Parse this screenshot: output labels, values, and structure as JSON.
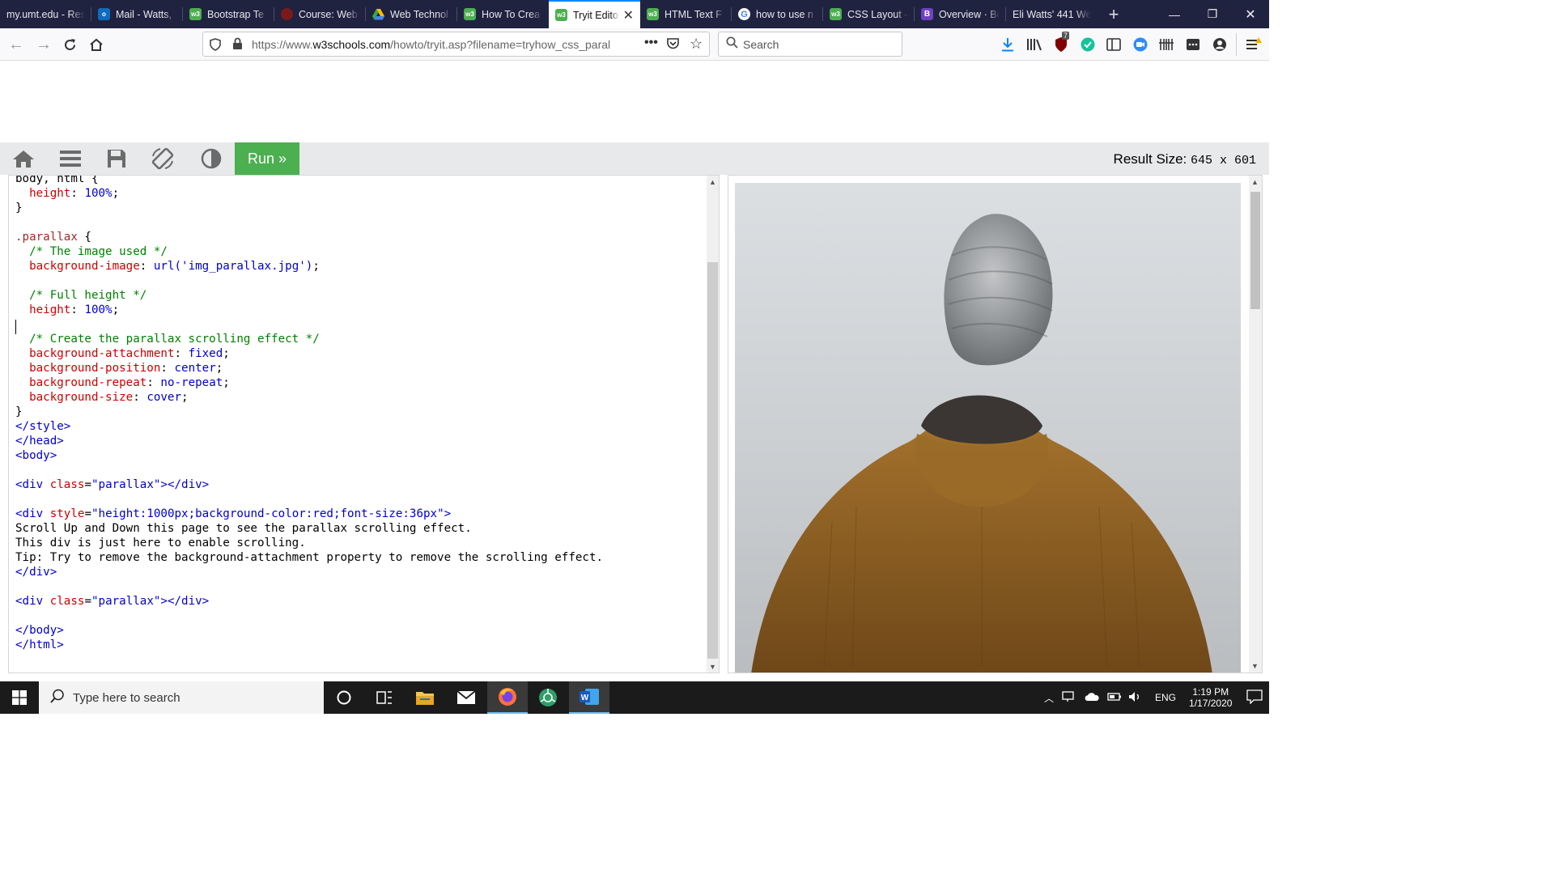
{
  "browser": {
    "tabs": [
      {
        "label": "my.umt.edu - Res",
        "icon": "none"
      },
      {
        "label": "Mail - Watts,",
        "icon": "outlook"
      },
      {
        "label": "Bootstrap Te",
        "icon": "w3"
      },
      {
        "label": "Course: Web",
        "icon": "moodle"
      },
      {
        "label": "Web Technol",
        "icon": "drive"
      },
      {
        "label": "How To Crea",
        "icon": "w3"
      },
      {
        "label": "Tryit Edito",
        "icon": "w3",
        "active": true
      },
      {
        "label": "HTML Text F",
        "icon": "w3"
      },
      {
        "label": "how to use n",
        "icon": "google"
      },
      {
        "label": "CSS Layout -",
        "icon": "w3"
      },
      {
        "label": "Overview · Bo",
        "icon": "bootstrap"
      },
      {
        "label": "Eli Watts' 441 We",
        "icon": "none"
      }
    ],
    "url_prefix": "https://www.",
    "url_domain": "w3schools.com",
    "url_rest": "/howto/tryit.asp?filename=tryhow_css_paral",
    "search_placeholder": "Search",
    "ublock_count": "7"
  },
  "editor": {
    "run_label": "Run »",
    "result_size_label": "Result Size:",
    "result_size_value": "645 x 601"
  },
  "taskbar": {
    "search_placeholder": "Type here to search",
    "language": "ENG",
    "time": "1:19 PM",
    "date": "1/17/2020"
  },
  "colors": {
    "tabstrip": "#202340",
    "run": "#4caf50",
    "toolbar": "#e7e9eb"
  }
}
